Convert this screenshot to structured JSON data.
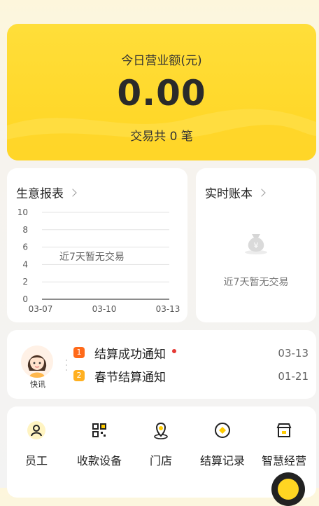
{
  "revenue": {
    "label": "今日营业额(元)",
    "amount": "0.00",
    "count_text": "交易共 0 笔",
    "accent": "#ffd522"
  },
  "report": {
    "title": "生意报表",
    "empty_text": "近7天暂无交易",
    "chart_data": {
      "type": "line",
      "categories": [
        "03-07",
        "03-10",
        "03-13"
      ],
      "yticks": [
        10,
        8,
        6,
        4,
        2,
        0
      ],
      "ylim": [
        0,
        10
      ],
      "series": [],
      "grid": true
    }
  },
  "ledger": {
    "title": "实时账本",
    "empty_text": "近7天暂无交易",
    "icon": "money-bag-icon"
  },
  "notices": {
    "avatar_caption": "快讯",
    "items": [
      {
        "index": "1",
        "title": "结算成功通知",
        "date": "03-13",
        "badge_color": "#ff6a1a",
        "unread": true
      },
      {
        "index": "2",
        "title": "春节结算通知",
        "date": "01-21",
        "badge_color": "#ffb020",
        "unread": false
      }
    ]
  },
  "functions": [
    {
      "label": "员工",
      "icon": "person-icon"
    },
    {
      "label": "收款设备",
      "icon": "qr-device-icon"
    },
    {
      "label": "门店",
      "icon": "location-pin-icon"
    },
    {
      "label": "结算记录",
      "icon": "coin-record-icon"
    },
    {
      "label": "智慧经营",
      "icon": "store-icon"
    }
  ]
}
